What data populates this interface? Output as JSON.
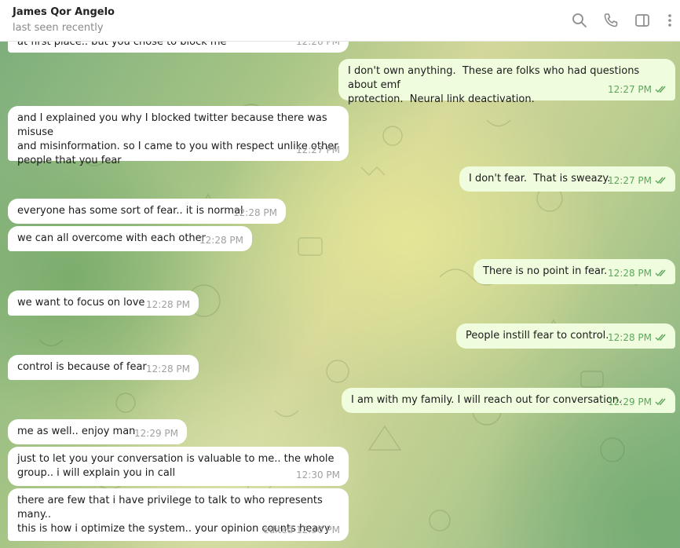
{
  "header": {
    "contact_name": "James Qor Angelo",
    "status": "last seen recently",
    "icons": [
      "search-icon",
      "phone-icon",
      "sidebar-toggle-icon",
      "more-vertical-icon"
    ]
  },
  "colors": {
    "incoming_bubble": "#ffffff",
    "outgoing_bubble": "#effdde",
    "outgoing_meta": "#5ea55d",
    "incoming_meta": "#a0a0a0"
  },
  "messages": [
    {
      "dir": "in",
      "text": "at first place.. but you chose to block me",
      "time": "12:26 PM"
    },
    {
      "dir": "out",
      "text": "I don't own anything.  These are folks who had questions about emf\nprotection.  Neural link deactivation.",
      "time": "12:27 PM"
    },
    {
      "dir": "in",
      "text": "and I explained you why I blocked twitter because there was misuse\nand misinformation. so I came to you with respect unlike other\npeople that you fear",
      "time": "12:27 PM"
    },
    {
      "dir": "out",
      "text": "I don't fear.  That is sweazy.",
      "time": "12:27 PM"
    },
    {
      "dir": "in",
      "text": "everyone has some sort of fear.. it is normal",
      "time": "12:28 PM"
    },
    {
      "dir": "in",
      "text": "we can all overcome with each other",
      "time": "12:28 PM"
    },
    {
      "dir": "out",
      "text": "There is no point in fear.",
      "time": "12:28 PM"
    },
    {
      "dir": "in",
      "text": "we want to focus on love",
      "time": "12:28 PM"
    },
    {
      "dir": "out",
      "text": "People instill fear to control.",
      "time": "12:28 PM"
    },
    {
      "dir": "in",
      "text": "control is because of fear",
      "time": "12:28 PM"
    },
    {
      "dir": "out",
      "text": "I am with my family. I will reach out for conversation.",
      "time": "12:29 PM"
    },
    {
      "dir": "in",
      "text": "me as well.. enjoy man",
      "time": "12:29 PM"
    },
    {
      "dir": "in",
      "text": "just to let you your conversation is valuable to me.. the whole\ngroup.. i will explain you in call",
      "time": "12:30 PM"
    },
    {
      "dir": "in",
      "text": "there are few that i have privilege to talk to who represents many..\nthis is how i optimize the system.. your opinion counts heavy",
      "time": "edited 12:30 PM"
    }
  ]
}
